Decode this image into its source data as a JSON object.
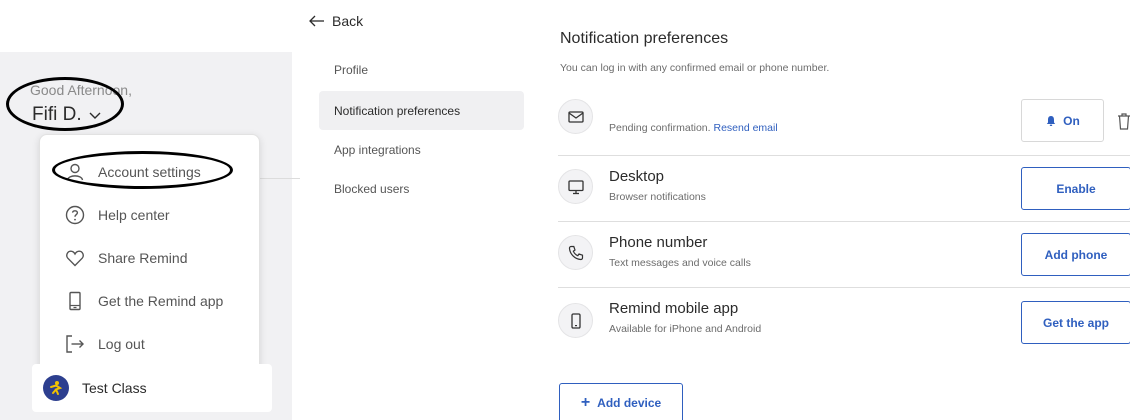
{
  "user": {
    "greeting": "Good Afternoon,",
    "name": "Fifi D."
  },
  "user_menu": {
    "items": [
      {
        "label": "Account settings",
        "icon": "person-icon"
      },
      {
        "label": "Help center",
        "icon": "question-circle-icon"
      },
      {
        "label": "Share Remind",
        "icon": "heart-icon"
      },
      {
        "label": "Get the Remind app",
        "icon": "phone-icon"
      },
      {
        "label": "Log out",
        "icon": "logout-icon"
      }
    ]
  },
  "class_card": {
    "name": "Test Class",
    "icon": "class-avatar-icon"
  },
  "back_label": "Back",
  "settings_nav": {
    "items": [
      {
        "label": "Profile",
        "active": false
      },
      {
        "label": "Notification preferences",
        "active": true
      },
      {
        "label": "App integrations",
        "active": false
      },
      {
        "label": "Blocked users",
        "active": false
      }
    ]
  },
  "main": {
    "title": "Notification preferences",
    "subtitle": "You can log in with any confirmed email or phone number.",
    "devices": [
      {
        "icon": "mail-icon",
        "title": "",
        "subtitle": "Pending confirmation.",
        "link": "Resend email",
        "button": "On"
      },
      {
        "icon": "desktop-icon",
        "title": "Desktop",
        "subtitle": "Browser notifications",
        "button": "Enable"
      },
      {
        "icon": "phone-call-icon",
        "title": "Phone number",
        "subtitle": "Text messages and voice calls",
        "button": "Add phone"
      },
      {
        "icon": "mobile-icon",
        "title": "Remind mobile app",
        "subtitle": "Available for iPhone and Android",
        "button": "Get the app"
      }
    ],
    "add_device_label": "Add device"
  },
  "colors": {
    "accent": "#2f5fbf",
    "panel_bg": "#f1f1f3",
    "annotation": "#000000"
  }
}
